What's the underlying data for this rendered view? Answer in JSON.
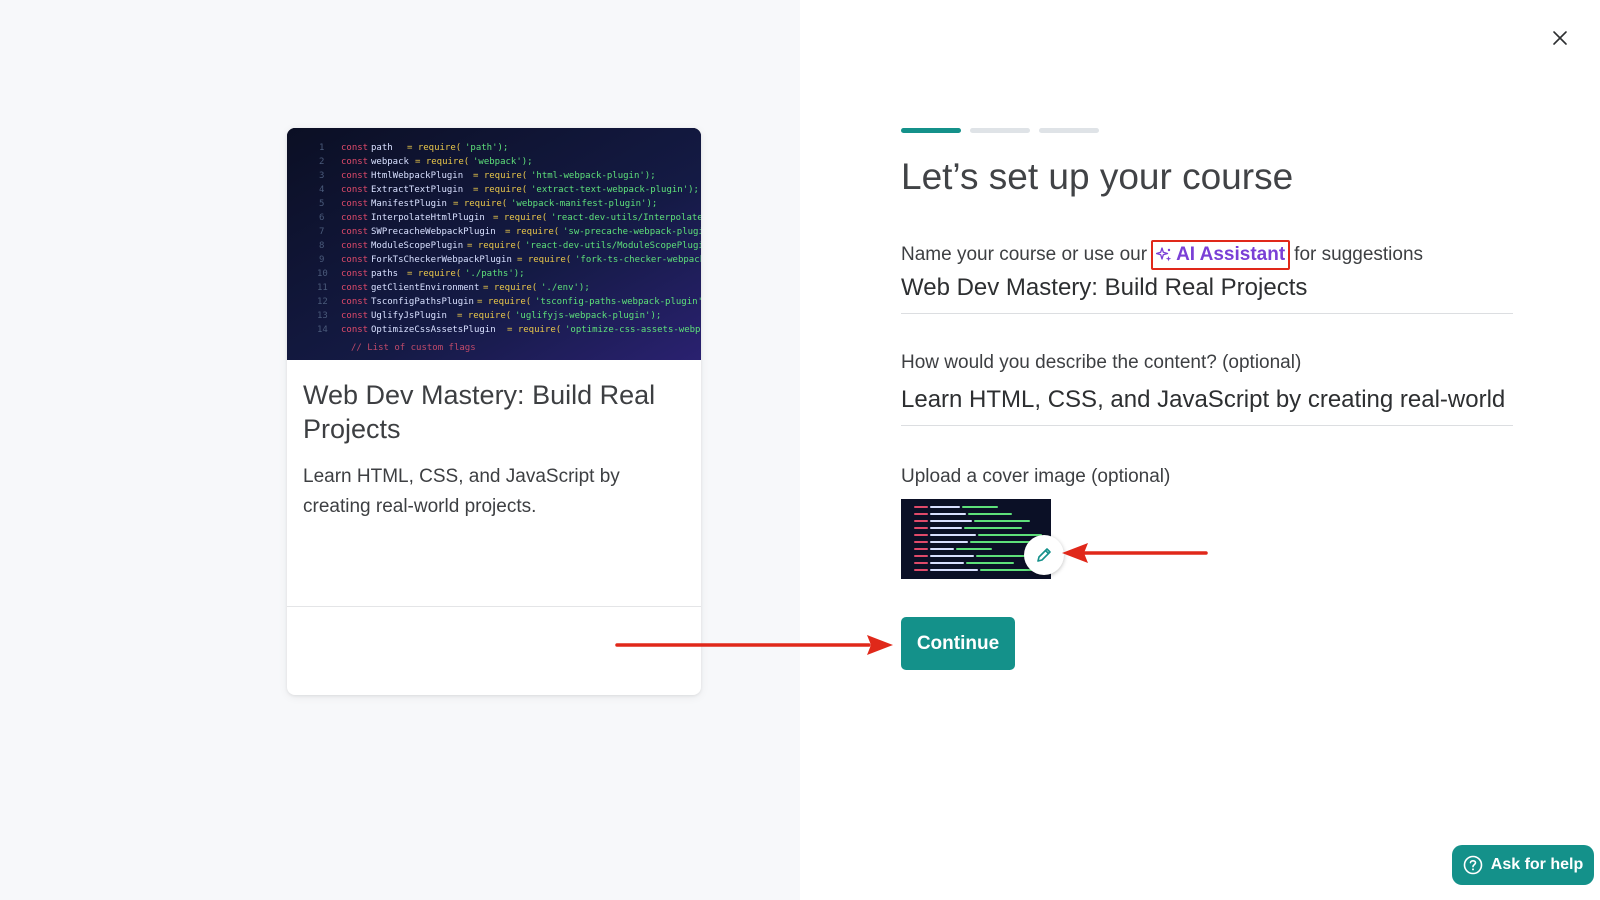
{
  "preview": {
    "title": "Web Dev Mastery: Build Real Projects",
    "description": "Learn HTML, CSS, and JavaScript by creating real-world projects."
  },
  "form": {
    "heading": "Let’s set up your course",
    "progress": {
      "current_step": 1,
      "total_steps": 3
    },
    "name_label_prefix": "Name your course or use our",
    "ai_assistant_label": "AI Assistant",
    "name_label_suffix": "for suggestions",
    "course_name_value": "Web Dev Mastery: Build Real Projects",
    "description_label": "How would you describe the content? (optional)",
    "description_value": "Learn HTML, CSS, and JavaScript by creating real-world projects.",
    "cover_label": "Upload a cover image (optional)",
    "continue_label": "Continue"
  },
  "help": {
    "label": "Ask for help"
  },
  "icons": {
    "close": "close-icon",
    "ai": "sparkle-icon",
    "edit": "pencil-icon",
    "help": "question-circle-icon"
  },
  "colors": {
    "accent": "#14918a",
    "ai_purple": "#7a3fd6",
    "annotation_red": "#e0281a"
  }
}
